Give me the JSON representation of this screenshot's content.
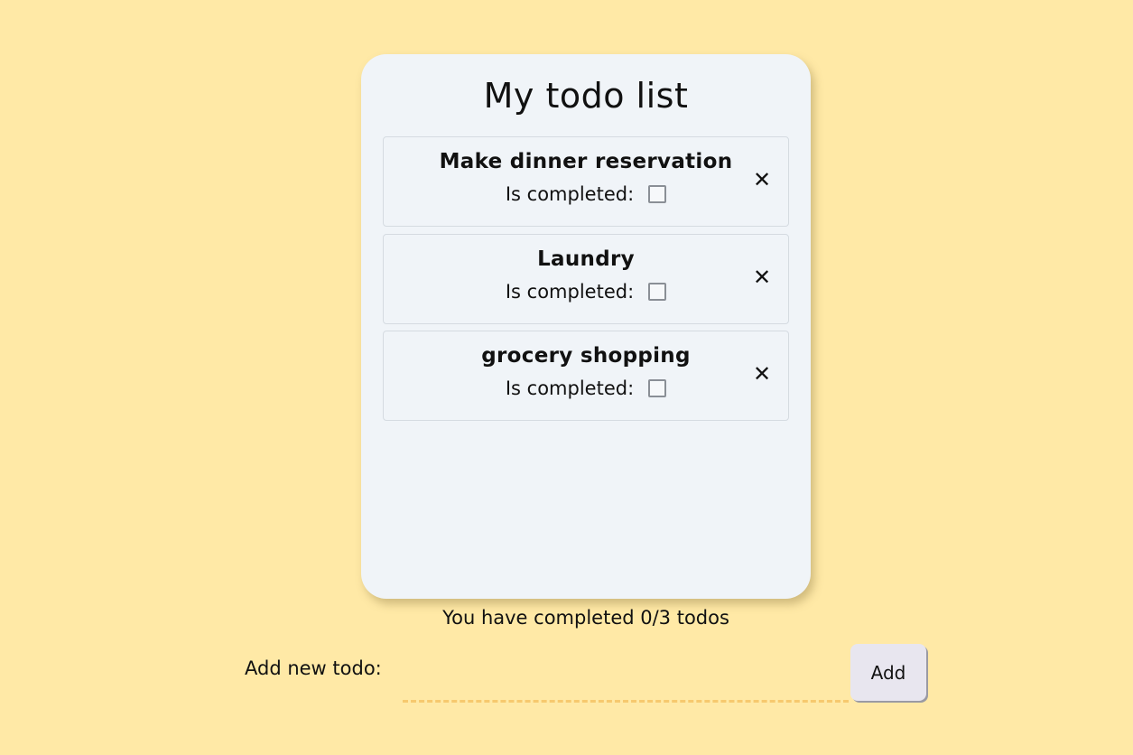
{
  "title": "My todo list",
  "status_label": "Is completed:",
  "delete_glyph": "✕",
  "todos": [
    {
      "title": "Make dinner reservation",
      "completed": false
    },
    {
      "title": "Laundry",
      "completed": false
    },
    {
      "title": "grocery shopping",
      "completed": false
    }
  ],
  "summary": "You have completed 0/3 todos",
  "add_form": {
    "label": "Add new todo:",
    "input_value": "",
    "button_label": "Add"
  },
  "colors": {
    "page_background": "#ffe9a6",
    "card_background": "#f0f4f8",
    "input_underline": "#f6c96e",
    "button_background": "#e8e6ef"
  }
}
